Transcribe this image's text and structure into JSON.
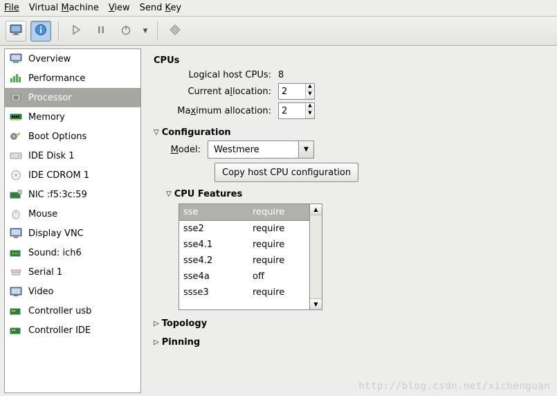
{
  "menubar": {
    "file": "File",
    "vm_pre": "Virtual ",
    "vm_u": "M",
    "vm_post": "achine",
    "view_u": "V",
    "view_post": "iew",
    "sendkey_pre": "Send ",
    "sendkey_u": "K",
    "sendkey_post": "ey"
  },
  "sidebar": {
    "items": [
      {
        "label": "Overview"
      },
      {
        "label": "Performance"
      },
      {
        "label": "Processor"
      },
      {
        "label": "Memory"
      },
      {
        "label": "Boot Options"
      },
      {
        "label": "IDE Disk 1"
      },
      {
        "label": "IDE CDROM 1"
      },
      {
        "label": "NIC :f5:3c:59"
      },
      {
        "label": "Mouse"
      },
      {
        "label": "Display VNC"
      },
      {
        "label": "Sound: ich6"
      },
      {
        "label": "Serial 1"
      },
      {
        "label": "Video"
      },
      {
        "label": "Controller usb"
      },
      {
        "label": "Controller IDE"
      }
    ]
  },
  "cpus": {
    "heading": "CPUs",
    "logical_label": "Logical host CPUs:",
    "logical_value": "8",
    "current_pre": "Current a",
    "current_u": "l",
    "current_post": "location:",
    "current_value": "2",
    "max_pre": "Ma",
    "max_u": "x",
    "max_post": "imum allocation:",
    "max_value": "2"
  },
  "config": {
    "heading": "Configuration",
    "model_pre": "",
    "model_u": "M",
    "model_post": "odel:",
    "model_value": "Westmere",
    "copy_button": "Copy host CPU configuration"
  },
  "cpu_features": {
    "heading": "CPU Features",
    "header_name": "sse",
    "header_val": "require",
    "rows": [
      {
        "name": "sse2",
        "val": "require"
      },
      {
        "name": "sse4.1",
        "val": "require"
      },
      {
        "name": "sse4.2",
        "val": "require"
      },
      {
        "name": "sse4a",
        "val": "off"
      },
      {
        "name": "ssse3",
        "val": "require"
      }
    ]
  },
  "topology": {
    "heading": "Topology"
  },
  "pinning": {
    "heading": "Pinning"
  },
  "watermark": "http://blog.csdn.net/xichenguan"
}
